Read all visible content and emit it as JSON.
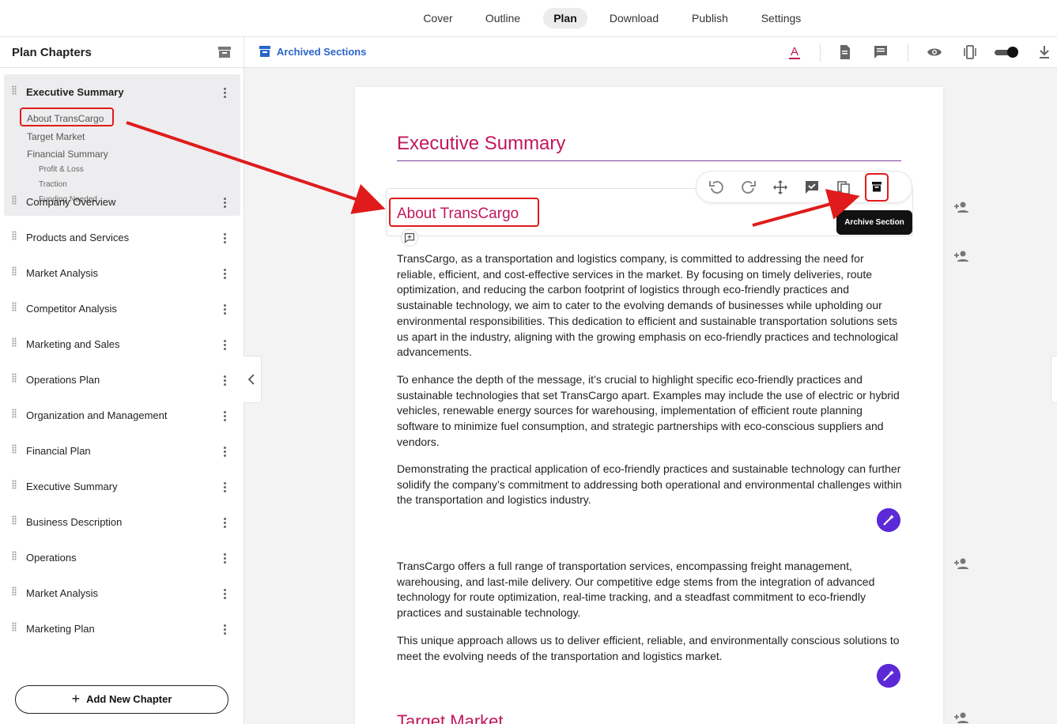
{
  "top_tabs": [
    "Cover",
    "Outline",
    "Plan",
    "Download",
    "Publish",
    "Settings"
  ],
  "active_tab": "Plan",
  "sidebar": {
    "title": "Plan Chapters",
    "active_chapter": {
      "label": "Executive Summary",
      "subsections": [
        {
          "label": "About TransCargo",
          "level": 1
        },
        {
          "label": "Target Market",
          "level": 1
        },
        {
          "label": "Financial Summary",
          "level": 1
        },
        {
          "label": "Profit & Loss",
          "level": 2
        },
        {
          "label": "Traction",
          "level": 2
        },
        {
          "label": "Funding Needed",
          "level": 2
        }
      ]
    },
    "chapters": [
      "Company Overview",
      "Products and Services",
      "Market Analysis",
      "Competitor Analysis",
      "Marketing and Sales",
      "Operations Plan",
      "Organization and Management",
      "Financial Plan",
      "Executive Summary",
      "Business Description",
      "Operations",
      "Market Analysis",
      "Marketing Plan"
    ],
    "add_button": "Add New Chapter"
  },
  "toolbar": {
    "archived_sections": "Archived Sections",
    "icons": [
      "text-color-icon",
      "document-icon",
      "comment-icon",
      "preview-icon",
      "page-width-icon",
      "toggle-switch",
      "download-icon"
    ]
  },
  "document": {
    "chapter_title": "Executive Summary",
    "section_title": "About TransCargo",
    "section_toolbar_icons": [
      "undo-icon",
      "redo-icon",
      "move-icon",
      "approve-icon",
      "duplicate-icon",
      "archive-icon"
    ],
    "tooltip": "Archive Section",
    "paragraphs_block1": [
      "TransCargo, as a transportation and logistics company, is committed to addressing the need for reliable, efficient, and cost-effective services in the market. By focusing on timely deliveries, route optimization, and reducing the carbon footprint of logistics through eco-friendly practices and sustainable technology, we aim to cater to the evolving demands of businesses while upholding our environmental responsibilities. This dedication to efficient and sustainable transportation solutions sets us apart in the industry, aligning with the growing emphasis on eco-friendly practices and technological advancements.",
      "To enhance the depth of the message, it’s crucial to highlight specific eco-friendly practices and sustainable technologies that set TransCargo apart. Examples may include the use of electric or hybrid vehicles, renewable energy sources for warehousing, implementation of efficient route planning software to minimize fuel consumption, and strategic partnerships with eco-conscious suppliers and vendors.",
      "Demonstrating the practical application of eco-friendly practices and sustainable technology can further solidify the company’s commitment to addressing both operational and environmental challenges within the transportation and logistics industry."
    ],
    "paragraphs_block2": [
      "TransCargo offers a full range of transportation services, encompassing freight management, warehousing, and last-mile delivery. Our competitive edge stems from the integration of advanced technology for route optimization, real-time tracking, and a steadfast commitment to eco-friendly practices and sustainable technology.",
      "This unique approach allows us to deliver efficient, reliable, and environmentally conscious solutions to meet the evolving needs of the transportation and logistics market."
    ],
    "next_section_title": "Target Market"
  },
  "colors": {
    "accent_title": "#c1185b",
    "link_blue": "#2a66c9",
    "magic_purple": "#5b2ad6",
    "highlight_red": "#e01b1b"
  }
}
